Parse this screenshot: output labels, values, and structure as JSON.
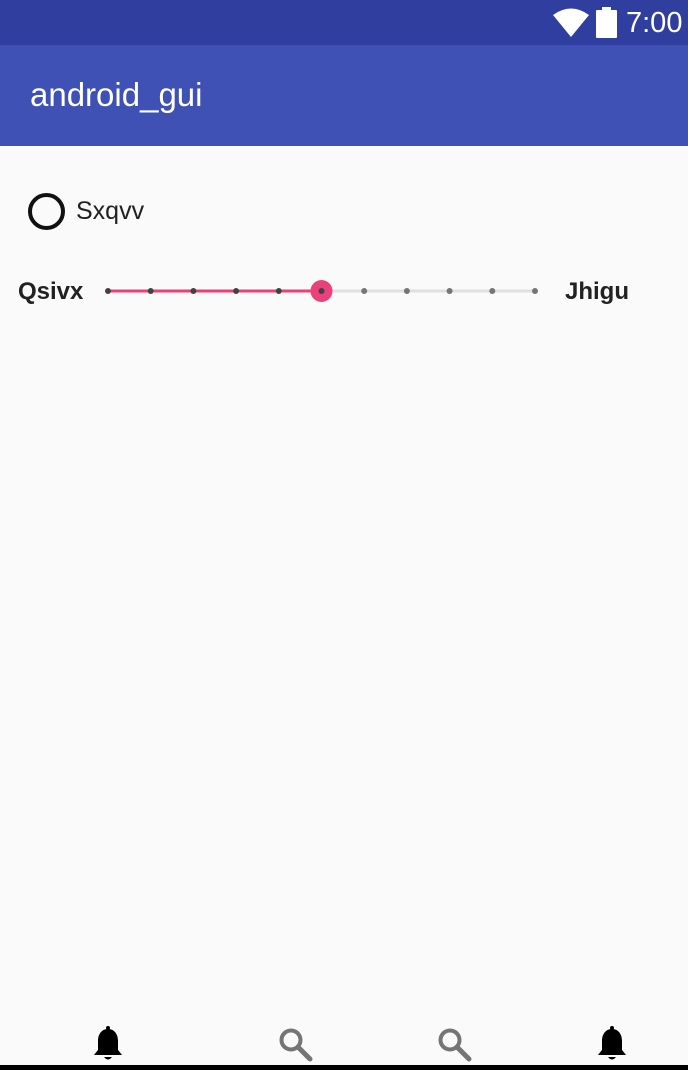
{
  "status_bar": {
    "time": "7:00",
    "icons": [
      "wifi-icon",
      "battery-icon"
    ]
  },
  "app_bar": {
    "title": "android_gui"
  },
  "radio": {
    "label": "Sxqvv",
    "checked": false
  },
  "slider": {
    "min_label": "Qsivx",
    "max_label": "Jhigu",
    "steps": 10,
    "value": 5,
    "active_color": "#ec407a",
    "inactive_color": "#e0e0e0"
  },
  "bottom_nav": {
    "items": [
      {
        "icon": "bell-icon",
        "color": "#000000"
      },
      {
        "icon": "search-icon",
        "color": "#757575"
      },
      {
        "icon": "search-icon",
        "color": "#757575"
      },
      {
        "icon": "bell-icon",
        "color": "#000000"
      }
    ]
  },
  "colors": {
    "status_bar": "#303f9f",
    "app_bar": "#3f51b5",
    "background": "#fafafa"
  }
}
